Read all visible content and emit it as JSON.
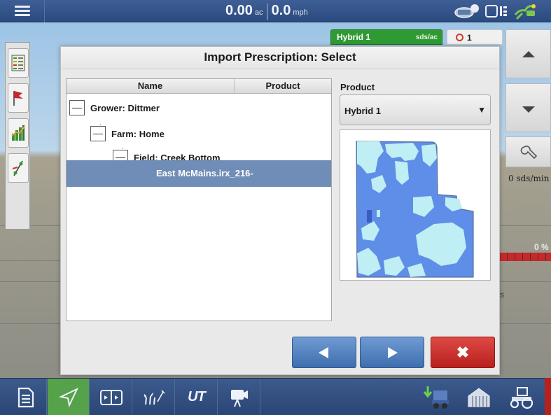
{
  "top_bar": {
    "area_value": "0.00",
    "area_unit": "ac",
    "speed_value": "0.0",
    "speed_unit": "mph"
  },
  "product_tab": {
    "name": "Hybrid 1",
    "rate_unit": "sds/ac",
    "alert_count": "1"
  },
  "right_panel": {
    "rate_readout": "0 sds/min",
    "percent": "0 %",
    "partial_text": "s"
  },
  "dialog": {
    "title": "Import Prescription: Select",
    "columns": {
      "name": "Name",
      "product": "Product"
    },
    "tree": {
      "grower": "Grower: Dittmer",
      "farm": "Farm: Home",
      "field": "Field: Creek Bottom",
      "prescription": "East McMains.irx_216-"
    },
    "product_label": "Product",
    "product_selected": "Hybrid 1",
    "cancel_glyph": "✖"
  },
  "bottom_bar": {
    "ut_label": "UT"
  },
  "colors": {
    "accent_blue": "#3e6eae",
    "selection_blue": "#6f8db6",
    "cancel_red": "#c62b27",
    "active_green": "#56a24b",
    "product_green": "#2f9a32",
    "map_light": "#bfeef4",
    "map_dark": "#5f8ee8"
  },
  "icons": {
    "menu": "menu-icon",
    "alert": "alert-circle-icon",
    "up": "up-arrow-icon",
    "down": "down-arrow-icon",
    "wrench": "wrench-icon",
    "back": "back-arrow-icon",
    "next": "next-arrow-icon",
    "cancel": "close-icon"
  }
}
